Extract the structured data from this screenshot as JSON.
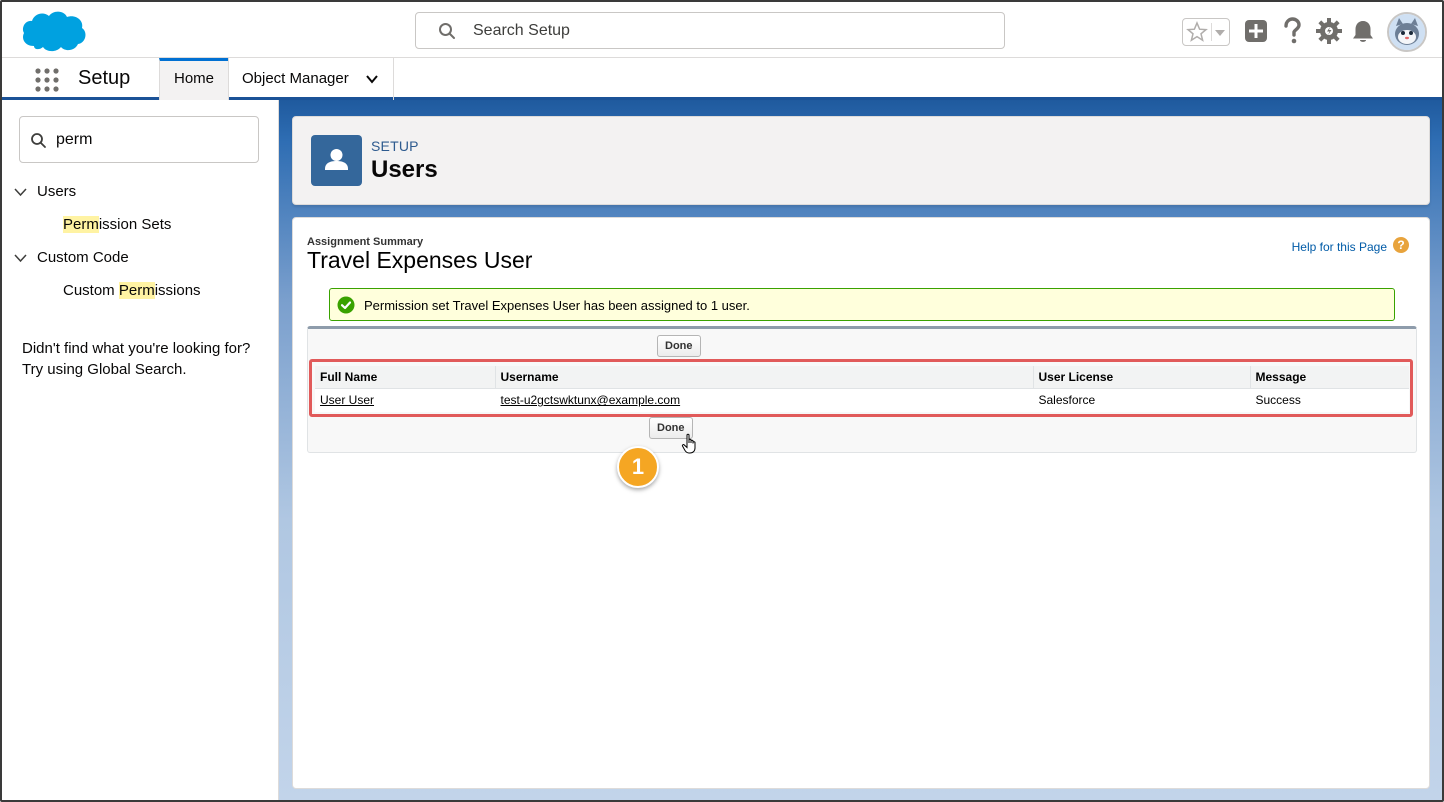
{
  "header": {
    "search_placeholder": "Search Setup",
    "icons": [
      "salesforce-cloud-logo",
      "search-icon",
      "star-icon",
      "chevron-down-icon",
      "plus-icon",
      "help-icon",
      "gear-icon",
      "bell-icon",
      "avatar"
    ]
  },
  "app_nav": {
    "app_name": "Setup",
    "tabs": [
      {
        "label": "Home",
        "active": true
      },
      {
        "label": "Object Manager",
        "active": false
      }
    ]
  },
  "sidebar": {
    "quick_find_value": "perm",
    "tree": [
      {
        "label": "Users",
        "children": [
          {
            "label_hl": "Perm",
            "label_rest": "ission Sets"
          }
        ]
      },
      {
        "label": "Custom Code",
        "children": [
          {
            "label_pre": "Custom ",
            "label_hl": "Perm",
            "label_rest": "issions"
          }
        ]
      }
    ],
    "not_found_line1": "Didn't find what you're looking for?",
    "not_found_line2": "Try using Global Search."
  },
  "page_header": {
    "eyebrow": "SETUP",
    "title": "Users"
  },
  "main": {
    "summary_label": "Assignment Summary",
    "summary_title": "Travel Expenses User",
    "help_link": "Help for this Page",
    "help_badge": "?",
    "message": "Permission set Travel Expenses User has been assigned to 1 user.",
    "done_label": "Done",
    "table": {
      "columns": [
        "Full Name",
        "Username",
        "User License",
        "Message"
      ],
      "rows": [
        {
          "full_name": "User User",
          "username": "test-u2gctswktunx@example.com",
          "license": "Salesforce",
          "message": "Success"
        }
      ]
    },
    "callout_number": "1"
  },
  "colors": {
    "brand": "#00a1e0",
    "nav_accent": "#0070d2",
    "highlight_box": "#e15a5a",
    "callout": "#f5a623",
    "success": "#39a200"
  }
}
